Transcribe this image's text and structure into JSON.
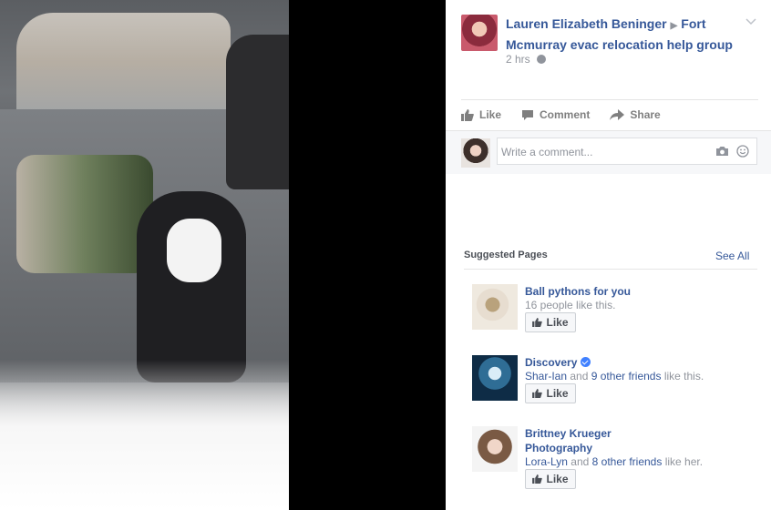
{
  "post": {
    "author": "Lauren Elizabeth Beninger",
    "group": "Fort Mcmurray evac relocation help group",
    "time": "2 hrs",
    "actions": {
      "like": "Like",
      "comment": "Comment",
      "share": "Share"
    },
    "comment_placeholder": "Write a comment..."
  },
  "suggested": {
    "title": "Suggested Pages",
    "see_all": "See All",
    "like_label": "Like",
    "pages": [
      {
        "name": "Ball pythons for you",
        "line": "16 people like this."
      },
      {
        "name": "Discovery",
        "friend": "Shar-Ian",
        "and": "and",
        "others": "9 other friends",
        "suffix": "like this.",
        "verified": true
      },
      {
        "name": "Brittney Krueger Photography",
        "friend": "Lora-Lyn",
        "and": "and",
        "others": "8 other friends",
        "suffix": "like her."
      }
    ]
  },
  "colors": {
    "link": "#365899",
    "muted": "#90949c"
  }
}
